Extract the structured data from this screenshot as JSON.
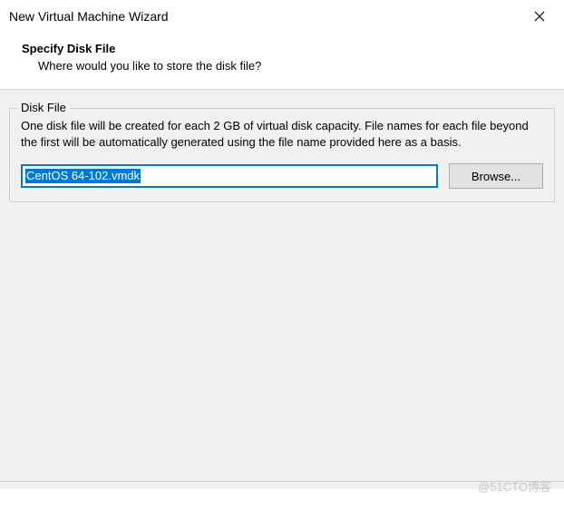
{
  "window": {
    "title": "New Virtual Machine Wizard"
  },
  "header": {
    "title": "Specify Disk File",
    "subtitle": "Where would you like to store the disk file?"
  },
  "diskFile": {
    "legend": "Disk File",
    "description": "One disk file will be created for each 2 GB of virtual disk capacity. File names for each file beyond the first will be automatically generated using the file name provided here as a basis.",
    "inputValue": "CentOS 64-102.vmdk",
    "browseLabel": "Browse..."
  },
  "watermark": "@51CTO博客"
}
